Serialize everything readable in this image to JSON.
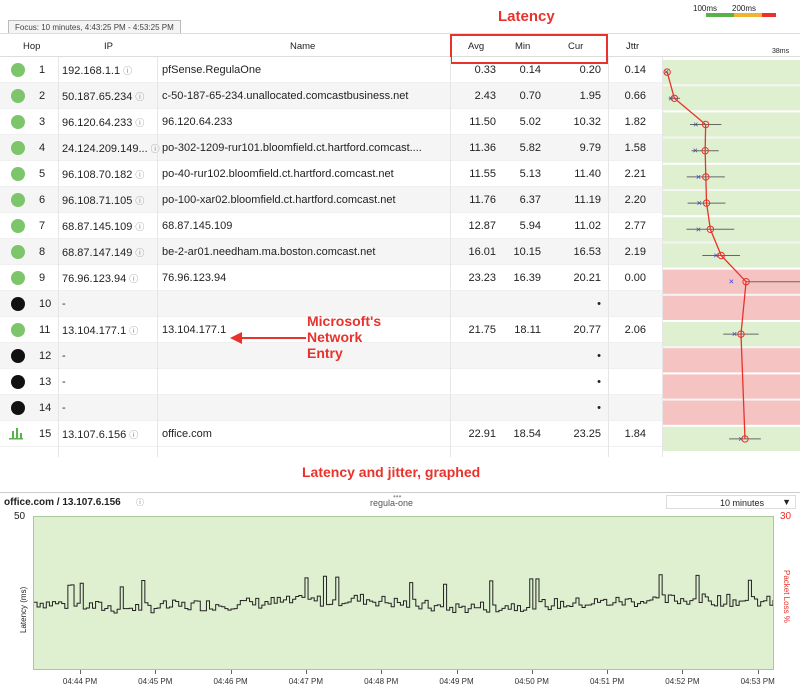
{
  "focus_label": "Focus: 10 minutes, 4:43:25 PM - 4:53:25 PM",
  "legend": {
    "ms100": "100ms",
    "ms200": "200ms",
    "colors": [
      "#58b14a",
      "#f2b233",
      "#e8322b"
    ]
  },
  "annotations": {
    "latency": "Latency",
    "microsoft": "Microsoft's\nNetwork\nEntry",
    "graphed": "Latency and jitter, graphed"
  },
  "table": {
    "headers": {
      "hop": "Hop",
      "ip": "IP",
      "name": "Name",
      "avg": "Avg",
      "min": "Min",
      "cur": "Cur",
      "jttr": "Jttr",
      "scale": "38ms"
    },
    "rows": [
      {
        "status": "ok",
        "hop": "1",
        "ip": "192.168.1.1",
        "name": "pfSense.RegulaOne",
        "avg": "0.33",
        "min": "0.14",
        "cur": "0.20",
        "jttr": "0.14"
      },
      {
        "status": "ok",
        "hop": "2",
        "ip": "50.187.65.234",
        "name": "c-50-187-65-234.unallocated.comcastbusiness.net",
        "avg": "2.43",
        "min": "0.70",
        "cur": "1.95",
        "jttr": "0.66"
      },
      {
        "status": "ok",
        "hop": "3",
        "ip": "96.120.64.233",
        "name": "96.120.64.233",
        "avg": "11.50",
        "min": "5.02",
        "cur": "10.32",
        "jttr": "1.82"
      },
      {
        "status": "ok",
        "hop": "4",
        "ip": "24.124.209.149...",
        "name": "po-302-1209-rur101.bloomfield.ct.hartford.comcast....",
        "avg": "11.36",
        "min": "5.82",
        "cur": "9.79",
        "jttr": "1.58"
      },
      {
        "status": "ok",
        "hop": "5",
        "ip": "96.108.70.182",
        "name": "po-40-rur102.bloomfield.ct.hartford.comcast.net",
        "avg": "11.55",
        "min": "5.13",
        "cur": "11.40",
        "jttr": "2.21"
      },
      {
        "status": "ok",
        "hop": "6",
        "ip": "96.108.71.105",
        "name": "po-100-xar02.bloomfield.ct.hartford.comcast.net",
        "avg": "11.76",
        "min": "6.37",
        "cur": "11.19",
        "jttr": "2.20"
      },
      {
        "status": "ok",
        "hop": "7",
        "ip": "68.87.145.109",
        "name": "68.87.145.109",
        "avg": "12.87",
        "min": "5.94",
        "cur": "11.02",
        "jttr": "2.77"
      },
      {
        "status": "ok",
        "hop": "8",
        "ip": "68.87.147.149",
        "name": "be-2-ar01.needham.ma.boston.comcast.net",
        "avg": "16.01",
        "min": "10.15",
        "cur": "16.53",
        "jttr": "2.19"
      },
      {
        "status": "ok",
        "hop": "9",
        "ip": "76.96.123.94",
        "name": "76.96.123.94",
        "avg": "23.23",
        "min": "16.39",
        "cur": "20.21",
        "jttr": "0.00"
      },
      {
        "status": "down",
        "hop": "10",
        "ip": "-",
        "name": "",
        "avg": "",
        "min": "",
        "cur": "•",
        "jttr": ""
      },
      {
        "status": "ok",
        "hop": "11",
        "ip": "13.104.177.1",
        "name": "13.104.177.1",
        "avg": "21.75",
        "min": "18.11",
        "cur": "20.77",
        "jttr": "2.06"
      },
      {
        "status": "down",
        "hop": "12",
        "ip": "-",
        "name": "",
        "avg": "",
        "min": "",
        "cur": "•",
        "jttr": ""
      },
      {
        "status": "down",
        "hop": "13",
        "ip": "-",
        "name": "",
        "avg": "",
        "min": "",
        "cur": "•",
        "jttr": ""
      },
      {
        "status": "down",
        "hop": "14",
        "ip": "-",
        "name": "",
        "avg": "",
        "min": "",
        "cur": "•",
        "jttr": ""
      },
      {
        "status": "dest",
        "hop": "15",
        "ip": "13.107.6.156",
        "name": "office.com",
        "avg": "22.91",
        "min": "18.54",
        "cur": "23.25",
        "jttr": "1.84"
      }
    ]
  },
  "panel": {
    "target": "office.com / 13.107.6.156",
    "source": "regula-one",
    "range_select": "10 minutes",
    "y_max_left": "50",
    "y_max_right": "30",
    "y_label_left": "Latency (ms)",
    "y_label_right": "Packet Loss %",
    "x_ticks": [
      "04:44 PM",
      "04:45 PM",
      "04:46 PM",
      "04:47 PM",
      "04:48 PM",
      "04:49 PM",
      "04:50 PM",
      "04:51 PM",
      "04:52 PM",
      "04:53 PM"
    ]
  },
  "chart_data": {
    "type": "line",
    "x": [
      "04:44 PM",
      "04:45 PM",
      "04:46 PM",
      "04:47 PM",
      "04:48 PM",
      "04:49 PM",
      "04:50 PM",
      "04:51 PM",
      "04:52 PM",
      "04:53 PM"
    ],
    "ylim": [
      0,
      50
    ],
    "y2lim": [
      0,
      30
    ],
    "ylabel": "Latency (ms)",
    "y2label": "Packet Loss %",
    "series": [
      {
        "values": [
          22,
          20,
          21,
          22,
          23,
          20,
          21,
          22,
          23,
          22
        ]
      }
    ]
  }
}
